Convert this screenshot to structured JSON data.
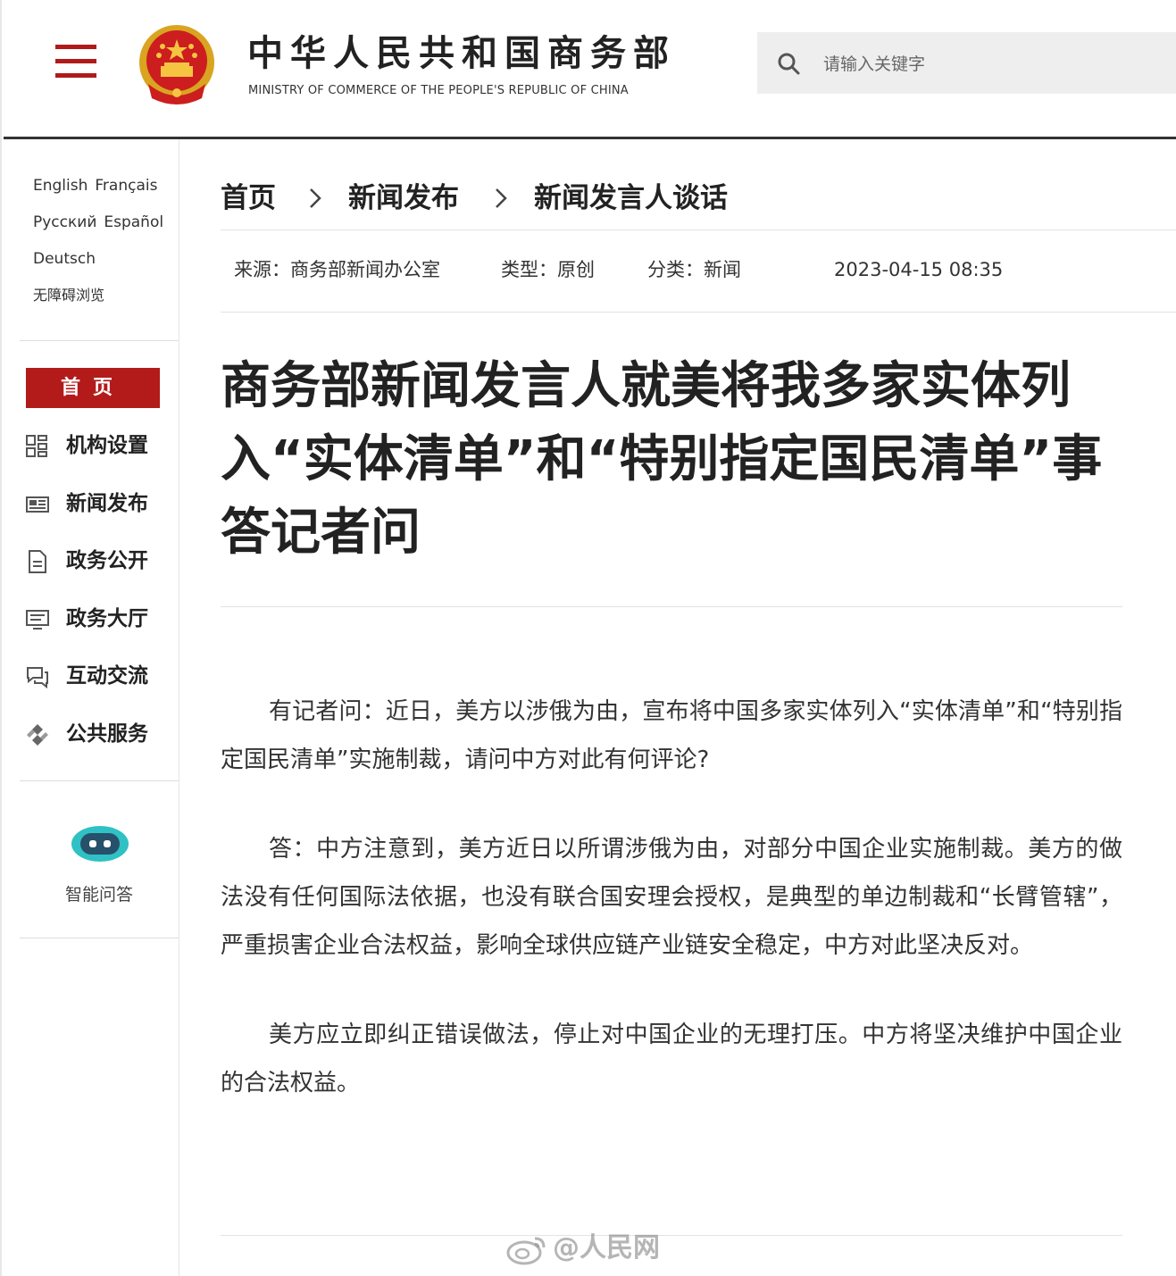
{
  "header": {
    "site_title": "中华人民共和国商务部",
    "site_subtitle": "MINISTRY OF COMMERCE OF THE PEOPLE'S REPUBLIC OF CHINA",
    "search_placeholder": "请输入关键字",
    "menu_icon": "hamburger-menu-icon",
    "emblem_icon": "national-emblem"
  },
  "sidebar": {
    "languages": [
      "English",
      "Français",
      "Русский",
      "Español",
      "Deutsch"
    ],
    "accessibility": "无障碍浏览",
    "home": "首页",
    "nav": [
      {
        "label": "机构设置",
        "icon": "grid-icon"
      },
      {
        "label": "新闻发布",
        "icon": "newspaper-icon"
      },
      {
        "label": "政务公开",
        "icon": "document-icon"
      },
      {
        "label": "政务大厅",
        "icon": "monitor-icon"
      },
      {
        "label": "互动交流",
        "icon": "chat-icon"
      },
      {
        "label": "公共服务",
        "icon": "service-icon"
      }
    ],
    "ai_label": "智能问答",
    "ai_icon": "robot-icon"
  },
  "breadcrumb": [
    "首页",
    "新闻发布",
    "新闻发言人谈话"
  ],
  "meta": {
    "source": "来源：商务部新闻办公室",
    "type": "类型：原创",
    "category": "分类：新闻",
    "datetime": "2023-04-15 08:35"
  },
  "article": {
    "title": "商务部新闻发言人就美将我多家实体列入“实体清单”和“特别指定国民清单”事答记者问",
    "paragraphs": [
      "有记者问：近日，美方以涉俄为由，宣布将中国多家实体列入“实体清单”和“特别指定国民清单”实施制裁，请问中方对此有何评论?",
      "答：中方注意到，美方近日以所谓涉俄为由，对部分中国企业实施制裁。美方的做法没有任何国际法依据，也没有联合国安理会授权，是典型的单边制裁和“长臂管辖”，严重损害企业合法权益，影响全球供应链产业链安全稳定，中方对此坚决反对。",
      "美方应立即纠正错误做法，停止对中国企业的无理打压。中方将坚决维护中国企业的合法权益。"
    ]
  },
  "watermark": "@人民网",
  "colors": {
    "brand_red": "#b31b1b",
    "ai_teal": "#2fc1c4"
  }
}
